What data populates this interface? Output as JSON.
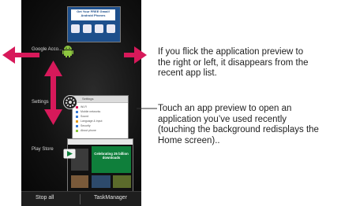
{
  "recent_apps": [
    {
      "label": "Google Acco...",
      "icon": "android-robot-icon"
    },
    {
      "label": "Settings",
      "icon": "settings-gear-icon"
    },
    {
      "label": "Play Store",
      "icon": "play-store-icon"
    }
  ],
  "preview_top": {
    "banner_line1": "Get Your FREE Gmail!",
    "banner_line2": "Android Phones"
  },
  "preview_settings": {
    "rows": [
      "Settings",
      "Wi-Fi",
      "Mobile networks",
      "Sound",
      "Language & input",
      "Security",
      "About phone"
    ]
  },
  "preview_store": {
    "headline": "Celebrating 25 billion downloads"
  },
  "bottom_bar": {
    "stop_all": "Stop all",
    "task_manager": "TaskManager"
  },
  "callouts": {
    "flick": [
      "If you flick the application preview to",
      "the right or left, it disappears from the",
      "recent app list."
    ],
    "touch": [
      "Touch an app preview to open an",
      "application you’ve used recently",
      "(touching the background redisplays the",
      "Home screen).."
    ]
  },
  "colors": {
    "arrow_red": "#d7195a",
    "phone_bg": "#0b0b0b",
    "android_green": "#8dc63f",
    "store_green": "#0f7f3b"
  }
}
